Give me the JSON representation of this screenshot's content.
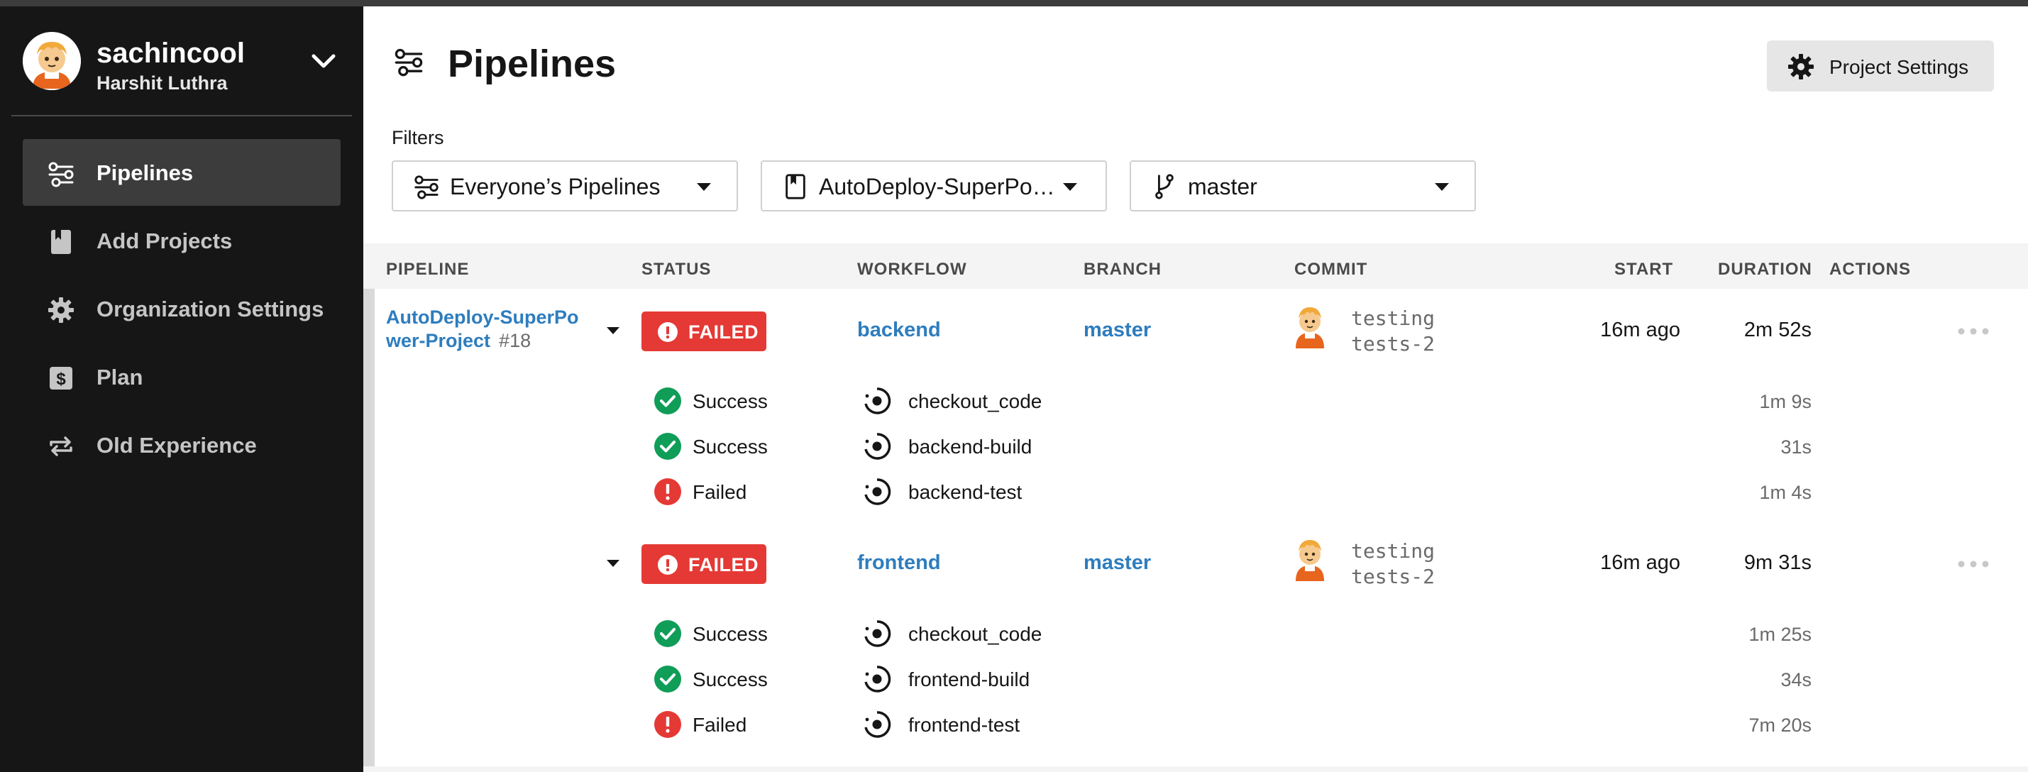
{
  "user": {
    "username": "sachincool",
    "full_name": "Harshit Luthra"
  },
  "sidebar": {
    "items": [
      {
        "label": "Pipelines",
        "icon": "pipelines-icon",
        "active": true
      },
      {
        "label": "Add Projects",
        "icon": "book-icon",
        "active": false
      },
      {
        "label": "Organization Settings",
        "icon": "gear-icon",
        "active": false
      },
      {
        "label": "Plan",
        "icon": "dollar-icon",
        "active": false
      },
      {
        "label": "Old Experience",
        "icon": "swap-arrows-icon",
        "active": false
      }
    ]
  },
  "header": {
    "title": "Pipelines",
    "settings_label": "Project Settings"
  },
  "filters": {
    "label": "Filters",
    "pipelines_value": "Everyone’s Pipelines",
    "project_value": "AutoDeploy-SuperPow…",
    "branch_value": "master"
  },
  "table": {
    "headers": {
      "pipeline": "PIPELINE",
      "status": "STATUS",
      "workflow": "WORKFLOW",
      "branch": "BRANCH",
      "commit": "COMMIT",
      "start": "START",
      "duration": "DURATION",
      "actions": "ACTIONS"
    },
    "pipeline": {
      "name_line1": "AutoDeploy-SuperPo",
      "name_line2": "wer-Project",
      "number": "#18"
    },
    "workflows": [
      {
        "status": "FAILED",
        "name": "backend",
        "branch": "master",
        "commit_line1": "testing",
        "commit_line2": "tests-2",
        "start": "16m ago",
        "duration": "2m 52s",
        "jobs": [
          {
            "status": "Success",
            "name": "checkout_code",
            "duration": "1m 9s"
          },
          {
            "status": "Success",
            "name": "backend-build",
            "duration": "31s"
          },
          {
            "status": "Failed",
            "name": "backend-test",
            "duration": "1m 4s"
          }
        ]
      },
      {
        "status": "FAILED",
        "name": "frontend",
        "branch": "master",
        "commit_line1": "testing",
        "commit_line2": "tests-2",
        "start": "16m ago",
        "duration": "9m 31s",
        "jobs": [
          {
            "status": "Success",
            "name": "checkout_code",
            "duration": "1m 25s"
          },
          {
            "status": "Success",
            "name": "frontend-build",
            "duration": "34s"
          },
          {
            "status": "Failed",
            "name": "frontend-test",
            "duration": "7m 20s"
          }
        ]
      }
    ]
  },
  "colors": {
    "sidebar_bg": "#161616",
    "link": "#2e7dbe",
    "failed": "#e53935",
    "success": "#0f9d58"
  }
}
